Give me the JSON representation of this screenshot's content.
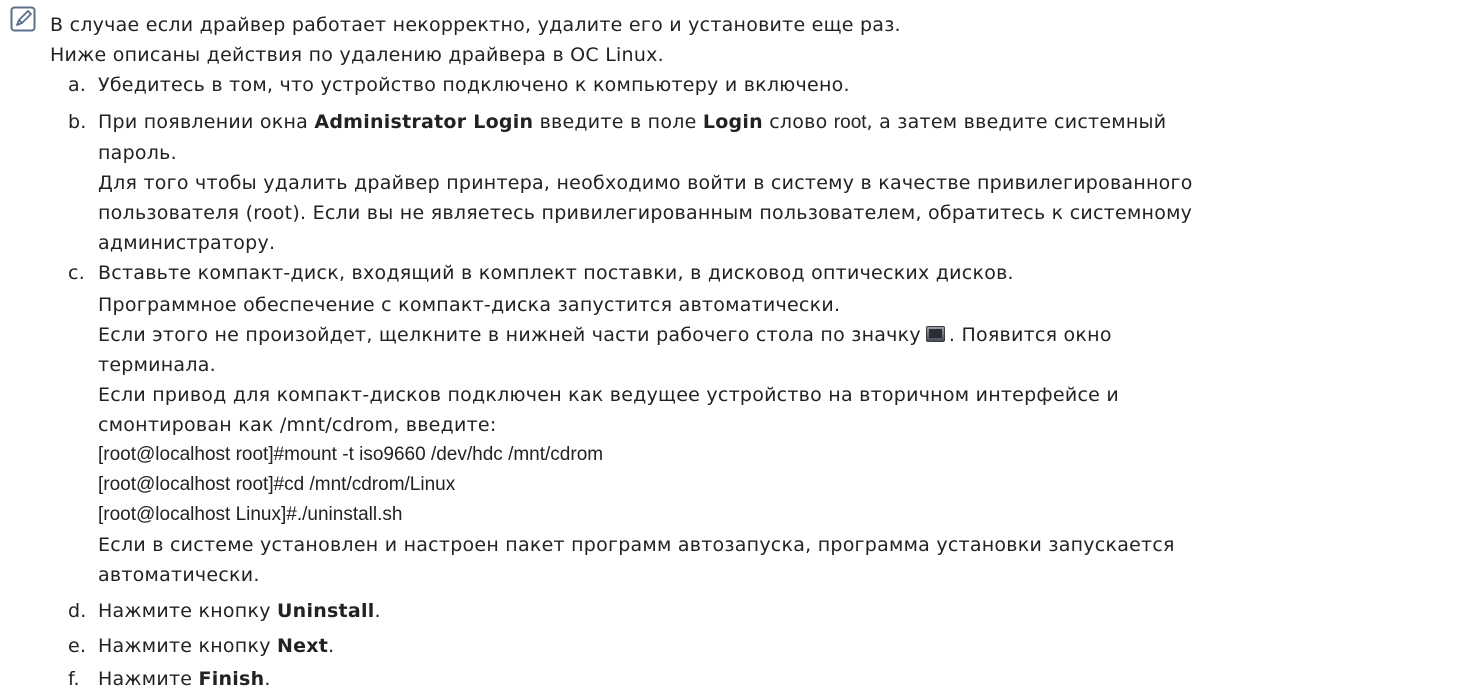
{
  "note": {
    "icon": "pencil-note-icon",
    "line1": "В случае если драйвер работает некорректно, удалите его и установите еще раз.",
    "line2": "Ниже описаны действия по удалению драйвера в ОС Linux."
  },
  "steps": {
    "a": {
      "letter": "a.",
      "text": "Убедитесь в том, что устройство подключено к компьютеру и включено."
    },
    "b": {
      "letter": "b.",
      "part1": "При появлении окна ",
      "bold1": "Administrator Login",
      "part2": " введите в поле ",
      "bold2": "Login",
      "part3": " слово ",
      "plain1": "root",
      "part4": ", а затем введите системный",
      "part5": "пароль.",
      "p2_line1": "Для того чтобы удалить драйвер принтера, необходимо войти в систему в качестве привилегированного",
      "p2_line2": "пользователя (root). Если вы не являетесь привилегированным пользователем, обратитесь к системному",
      "p2_line3": "администратору."
    },
    "c": {
      "letter": "c.",
      "line1": "Вставьте компакт-диск, входящий в комплект поставки, в дисковод оптических дисков.",
      "line2": "Программное обеспечение с компакт-диска запустится автоматически.",
      "line3_before": "Если этого не произойдет, щелкните в нижней части рабочего стола по значку",
      "line3_after": ". Появится окно",
      "line4": "терминала.",
      "line5": "Если привод для компакт-дисков подключен как ведущее устройство на вторичном интерфейсе и",
      "line6": "смонтирован как /mnt/cdrom, введите:",
      "cmd1": "[root@localhost root]#mount -t iso9660 /dev/hdc /mnt/cdrom",
      "cmd2": "[root@localhost root]#cd /mnt/cdrom/Linux",
      "cmd3": "[root@localhost Linux]#./uninstall.sh",
      "line7": "Если в системе установлен и настроен пакет программ автозапуска, программа установки запускается",
      "line8": "автоматически."
    },
    "d": {
      "letter": "d.",
      "before": "Нажмите кнопку ",
      "bold": "Uninstall",
      "after": "."
    },
    "e": {
      "letter": "e.",
      "before": "Нажмите кнопку ",
      "bold": "Next",
      "after": "."
    },
    "f": {
      "letter": "f.",
      "before": "Нажмите ",
      "bold": "Finish",
      "after": "."
    }
  }
}
